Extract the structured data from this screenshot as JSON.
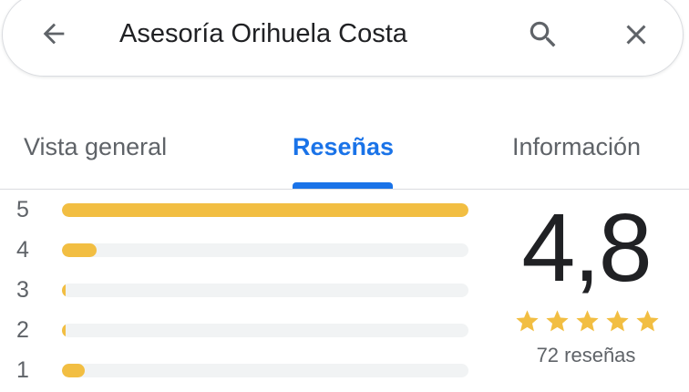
{
  "search": {
    "query": "Asesoría Orihuela Costa",
    "back_icon": "arrow-left-icon",
    "search_icon": "search-icon",
    "close_icon": "close-icon"
  },
  "tabs": [
    {
      "label": "Vista general",
      "active": false
    },
    {
      "label": "Reseñas",
      "active": true
    },
    {
      "label": "Información",
      "active": false
    }
  ],
  "ratings": {
    "distribution": [
      {
        "stars": "5",
        "fraction": 1.0
      },
      {
        "stars": "4",
        "fraction": 0.085
      },
      {
        "stars": "3",
        "fraction": 0.01
      },
      {
        "stars": "2",
        "fraction": 0.01
      },
      {
        "stars": "1",
        "fraction": 0.055
      }
    ],
    "average": "4,8",
    "stars_shown": 5,
    "review_count": "72 reseñas"
  },
  "colors": {
    "accent": "#1a73e8",
    "bar_fill": "#f2be42",
    "bar_track": "#f1f3f4",
    "star": "#f2be42",
    "text_primary": "#202124",
    "text_secondary": "#5f6368"
  }
}
